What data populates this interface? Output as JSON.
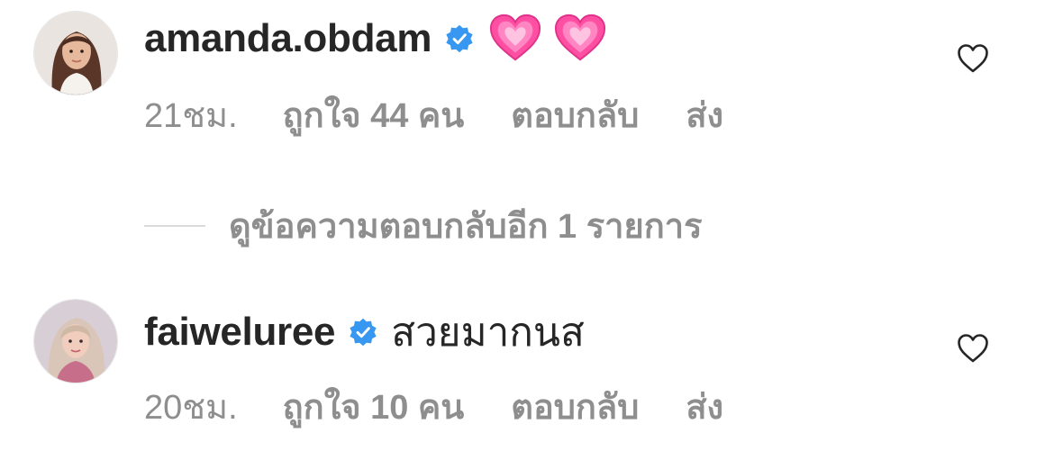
{
  "comments": [
    {
      "username": "amanda.obdam",
      "verified": true,
      "text": "",
      "emoji": [
        "pink-heart",
        "pink-heart"
      ],
      "time": "21ชม.",
      "likes": "ถูกใจ 44 คน",
      "reply": "ตอบกลับ",
      "send": "ส่ง"
    },
    {
      "username": "faiweluree",
      "verified": true,
      "text": "สวยมากนส",
      "time": "20ชม.",
      "likes": "ถูกใจ 10 คน",
      "reply": "ตอบกลับ",
      "send": "ส่ง"
    }
  ],
  "view_replies": "ดูข้อความตอบกลับอีก 1 รายการ",
  "colors": {
    "text": "#262626",
    "secondary": "#8e8e8e",
    "verified": "#3897f0",
    "divider": "#dbdbdb",
    "heart": "#ff4fa3"
  }
}
